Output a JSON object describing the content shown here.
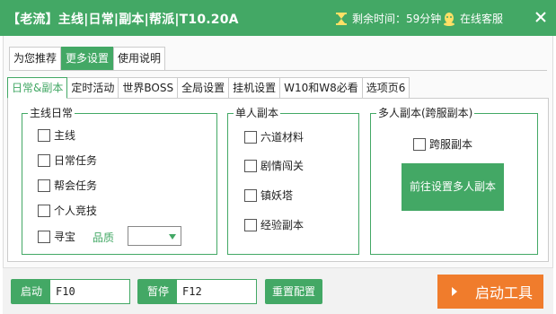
{
  "titlebar": {
    "title": "【老流】主线|日常|副本|帮派|T10.20A",
    "timer_text": "剩余时间：59分钟",
    "service_text": "在线客服"
  },
  "top_tabs": [
    {
      "label": "为您推荐",
      "active": false
    },
    {
      "label": "更多设置",
      "active": true
    },
    {
      "label": "使用说明",
      "active": false
    }
  ],
  "sub_tabs": [
    {
      "label": "日常&副本",
      "active": true
    },
    {
      "label": "定时活动",
      "active": false
    },
    {
      "label": "世界BOSS",
      "active": false
    },
    {
      "label": "全局设置",
      "active": false
    },
    {
      "label": "挂机设置",
      "active": false
    },
    {
      "label": "W10和W8必看",
      "active": false
    },
    {
      "label": "选项页6",
      "active": false
    }
  ],
  "main_daily": {
    "legend": "主线日常",
    "items": [
      "主线",
      "日常任务",
      "帮会任务",
      "个人竞技",
      "寻宝"
    ],
    "quality_label": "品质",
    "quality_value": ""
  },
  "single_dungeon": {
    "legend": "单人副本",
    "items": [
      "六道材料",
      "剧情闯关",
      "镇妖塔",
      "经验副本"
    ]
  },
  "multi_dungeon": {
    "legend": "多人副本(跨服副本)",
    "items": [
      "跨服副本"
    ],
    "goto_button": "前往设置多人副本"
  },
  "bottom": {
    "start_label": "启动",
    "start_key": "F10",
    "pause_label": "暂停",
    "pause_key": "F12",
    "reset_label": "重置配置",
    "launch_label": "启动工具"
  },
  "colors": {
    "accent": "#43a865",
    "launch": "#f07c2c"
  }
}
